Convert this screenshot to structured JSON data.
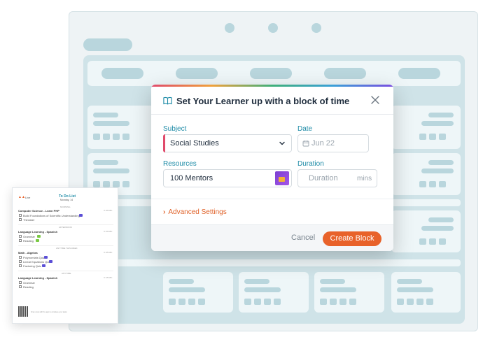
{
  "modal": {
    "title": "Set Your Learner up with a block of time",
    "subject_label": "Subject",
    "subject_value": "Social Studies",
    "date_label": "Date",
    "date_placeholder": "Jun 22",
    "resources_label": "Resources",
    "resources_value": "100 Mentors",
    "duration_label": "Duration",
    "duration_placeholder": "Duration",
    "duration_unit": "mins",
    "advanced_settings": "Advanced Settings",
    "cancel_label": "Cancel",
    "create_label": "Create Block"
  },
  "sheet": {
    "logo_text": "Live",
    "title": "To Do List",
    "subtitle": "Monday, 14",
    "morning": "MORNING",
    "afternoon": "AFTERNOON",
    "anytime": "ANYTIME THIS WEEK",
    "anytime2": "ANYTIME",
    "time_a": "⊙ 30 Min",
    "time_b": "⊙ 20 Min",
    "time_c": "⊙ 45 Min",
    "time_d": "⊙ 15 Min",
    "groups": [
      {
        "heading": "Computer Science - Learn PHP",
        "items": [
          "Build Foundations of Scientific Understanding",
          "Thinkster"
        ]
      },
      {
        "heading": "Language Learning - Spanish",
        "items": [
          "Grammar",
          "Reading"
        ]
      },
      {
        "heading": "Math - Algebra",
        "items": [
          "Polynomials Quiz",
          "Linear Equations Quiz",
          "Factoring Quiz"
        ]
      },
      {
        "heading": "Language Learning - Spanish",
        "items": [
          "Grammar",
          "Reading"
        ]
      }
    ],
    "footer_note": "Scan code with the app to complete your tasks"
  },
  "colors": {
    "accent": "#e8622a",
    "label": "#1c8aa6",
    "subject_accent": "#e04a6b",
    "planner_tile": "#b9d6dd"
  },
  "icons": {
    "title": "book-open-icon",
    "close": "close-icon",
    "select": "chevron-down-icon",
    "date": "calendar-icon",
    "advanced": "chevron-right-icon"
  }
}
